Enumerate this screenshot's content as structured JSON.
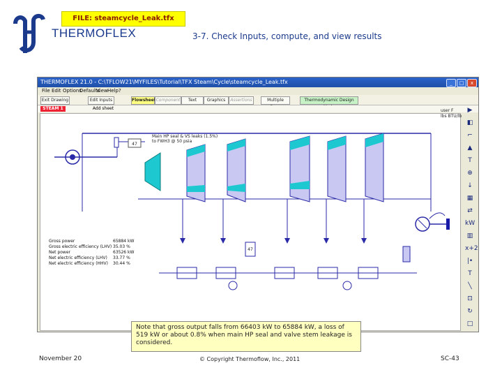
{
  "slide": {
    "file_label": "FILE: steamcycle_Leak.tfx",
    "brand": "THERMOFLEX",
    "subtitle": "3-7. Check Inputs, compute, and view results",
    "footer_left": "November 20",
    "footer_center": "© Copyright Thermoflow, Inc., 2011",
    "footer_right": "SC-43",
    "note": "Note that gross output falls from 66403 kW to 65884 kW, a loss of 519 kW or about 0.8% when main HP seal and valve stem leakage is considered."
  },
  "app": {
    "title": "THERMOFLEX 21.0 - C:\\TFLOW21\\MYFILES\\Tutorial\\TFX Steam\\Cycle\\steamcycle_Leak.tfx",
    "menus": [
      "File",
      "Edit",
      "Options",
      "Defaults",
      "View",
      "Help",
      "?"
    ],
    "toolbar": [
      "Exit Drawing",
      "Edit Inputs",
      "Flowsheets",
      "Component",
      "Text",
      "Graphics",
      "Assertions",
      "Multiple Runs",
      "Thermodynamic Design Mode"
    ],
    "tabs": [
      "STEAM 1",
      "Add sheet"
    ],
    "right_tools": [
      "▶",
      "◧",
      "⌐",
      "▲",
      "T",
      "⊕",
      "↓",
      "▦",
      "⇄",
      "kW",
      "▥",
      "x+2",
      "|•",
      "T",
      "╲",
      "⊡",
      "↻",
      "□"
    ],
    "leak_label_value": "47",
    "leak_label_text_1": "Main HP seal & VS leaks (1.5%)",
    "leak_label_text_2": "to FWH3 @ 50 psia",
    "drain_label": "47",
    "summary_rows": [
      {
        "label": "Gross power",
        "value": "65884 kW"
      },
      {
        "label": "Gross electric efficiency (LHV)",
        "value": "35.03 %"
      },
      {
        "label": "Net power",
        "value": "63526 kW"
      },
      {
        "label": "Net electric efficiency (LHV)",
        "value": "33.77 %"
      },
      {
        "label": "Net electric efficiency (HHV)",
        "value": "30.44 %"
      }
    ],
    "units_top": "user F",
    "units_bottom": "lbs BTU/lb"
  },
  "colors": {
    "turbine": "#1ec8d0",
    "stage_fill": "#c8c8f2",
    "pipe": "#2a2aa8",
    "title_bar": "#2b63c9",
    "callout_bg": "#ffffc0"
  }
}
